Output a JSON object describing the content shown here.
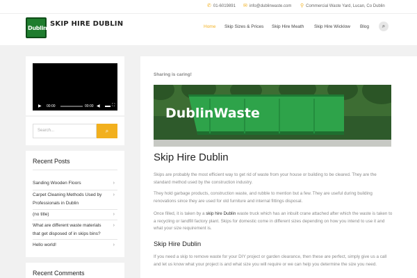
{
  "topbar": {
    "phone": "01-6019891",
    "email": "info@dublinwaste.com",
    "address": "Commercial Waste Yard, Lucan, Co Dublin",
    "phone_icon": "phone-icon",
    "email_icon": "envelope-icon",
    "address_icon": "map-pin-icon"
  },
  "header": {
    "logo_text": "Dublin",
    "site_title": "SKIP HIRE DUBLIN",
    "nav": [
      "Home",
      "Skip Sizes & Prices",
      "Skip Hire Meath",
      "Skip Hire Wicklow",
      "Blog"
    ],
    "active_nav": "Home",
    "accent_color": "#f2b01e"
  },
  "sidebar": {
    "video": {
      "current_time": "00:00",
      "duration": "00:00"
    },
    "search": {
      "placeholder": "Search..."
    },
    "recent_posts": {
      "title": "Recent Posts",
      "items": [
        "Sanding Wooden Floors",
        "Carpet Cleaning Methods Used by Professionals in Dublin",
        "(no title)",
        "What are different waste materials that get disposed of in skips bins?",
        "Hello world!"
      ]
    },
    "recent_comments": {
      "title": "Recent Comments"
    }
  },
  "main": {
    "sharing": "Sharing is caring!",
    "banner_text": "DublinWaste",
    "title": "Skip Hire Dublin",
    "p1": "Skips are probably the most efficient way to get rid of waste from your house or building to be cleared. They are the standard method used by the construction industry.",
    "p2": "They hold garbage products, construction waste, and rubble to mention but a few. They are useful during building renovations since they are used for old furniture and internal fittings disposal.",
    "p3_before": "Once filled, it is taken by a ",
    "p3_link": "skip hire Dublin",
    "p3_after": " waste truck which has an inbuilt crane attached after which the waste is taken to a recycling or landfill factory plant. Skips for domestic come in different sizes depending on how you intend to use it and what your size requirement is.",
    "subtitle": "Skip Hire Dublin",
    "p4": "If you need a skip to remove waste for your DIY project or garden clearance, then these are perfect, simply give us a call and let us know what your project is and what size you will require or we can help you determine the size you need."
  }
}
